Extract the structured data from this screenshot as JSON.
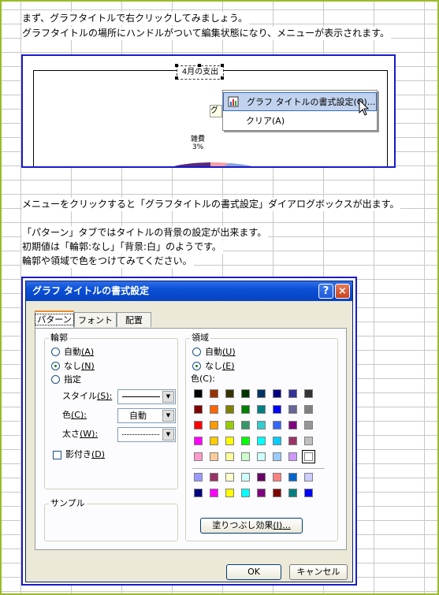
{
  "intro": {
    "line1": "まず、グラフタイトルで右クリックしてみましょう。",
    "line2": "グラフタイトルの場所にハンドルがついて編集状態になり、メニューが表示されます。"
  },
  "chart": {
    "title_text": "4月の支出",
    "hidden_label": "グ",
    "pie_label_name": "雑費",
    "pie_label_pct": "3%",
    "context_menu": {
      "items": [
        {
          "label": "グラフ タイトルの書式設定(O)...",
          "icon": "format-icon"
        },
        {
          "label": "クリア(A)"
        }
      ]
    },
    "colors": {
      "pie_purple": "#5a2a7a",
      "pie_pink": "#f3a0a8",
      "pie_blue": "#8aa3d8"
    }
  },
  "middle_text": {
    "line1": "メニューをクリックすると「グラフタイトルの書式設定」ダイアログボックスが出ます。",
    "line2": "「パターン」タブではタイトルの背景の設定が出来ます。",
    "line3": "初期値は「輪郭:なし」「背景:白」のようです。",
    "line4": "輪郭や領域で色をつけてみてください。"
  },
  "dialog": {
    "title": "グラフ タイトルの書式設定",
    "help_glyph": "?",
    "close_glyph": "×",
    "tabs": [
      {
        "label": "パターン",
        "active": true
      },
      {
        "label": "フォント",
        "active": false
      },
      {
        "label": "配置",
        "active": false
      }
    ],
    "border_group": {
      "title": "輪郭",
      "auto_label": "自動",
      "auto_key": "(A)",
      "none_label": "なし",
      "none_key": "(N)",
      "custom_label": "指定",
      "selected": "none",
      "style_label": "スタイル",
      "style_key": "(S):",
      "color_label": "色",
      "color_key": "(C):",
      "color_value": "自動",
      "weight_label": "太さ",
      "weight_key": "(W):",
      "shadow_label": "影付き",
      "shadow_key": "(D)",
      "shadow_checked": false
    },
    "area_group": {
      "title": "領域",
      "auto_label": "自動",
      "auto_key": "(U)",
      "none_label": "なし",
      "none_key": "(E)",
      "selected": "none",
      "color_label": "色(C):",
      "fill_effects_label": "塗りつぶし効果",
      "fill_effects_key": "(I)...",
      "palette_main": [
        [
          "#000000",
          "#993300",
          "#333300",
          "#003300",
          "#003366",
          "#000080",
          "#333399",
          "#333333"
        ],
        [
          "#800000",
          "#ff6600",
          "#808000",
          "#008000",
          "#008080",
          "#0000ff",
          "#666699",
          "#808080"
        ],
        [
          "#ff0000",
          "#ff9900",
          "#99cc00",
          "#339966",
          "#33cccc",
          "#3366ff",
          "#800080",
          "#969696"
        ],
        [
          "#ff00ff",
          "#ffcc00",
          "#ffff00",
          "#00ff00",
          "#00ffff",
          "#00ccff",
          "#993366",
          "#c0c0c0"
        ],
        [
          "#ff99cc",
          "#ffcc99",
          "#ffff99",
          "#ccffcc",
          "#ccffff",
          "#99ccff",
          "#cc99ff",
          "#ffffff"
        ]
      ],
      "palette_chart": [
        [
          "#9999ff",
          "#993366",
          "#ffffcc",
          "#ccffff",
          "#660066",
          "#ff8080",
          "#0066cc",
          "#ccccff"
        ],
        [
          "#000080",
          "#ff00ff",
          "#ffff00",
          "#00ffff",
          "#800080",
          "#800000",
          "#008080",
          "#0000ff"
        ]
      ]
    },
    "sample_label": "サンプル",
    "ok_label": "OK",
    "cancel_label": "キャンセル"
  }
}
